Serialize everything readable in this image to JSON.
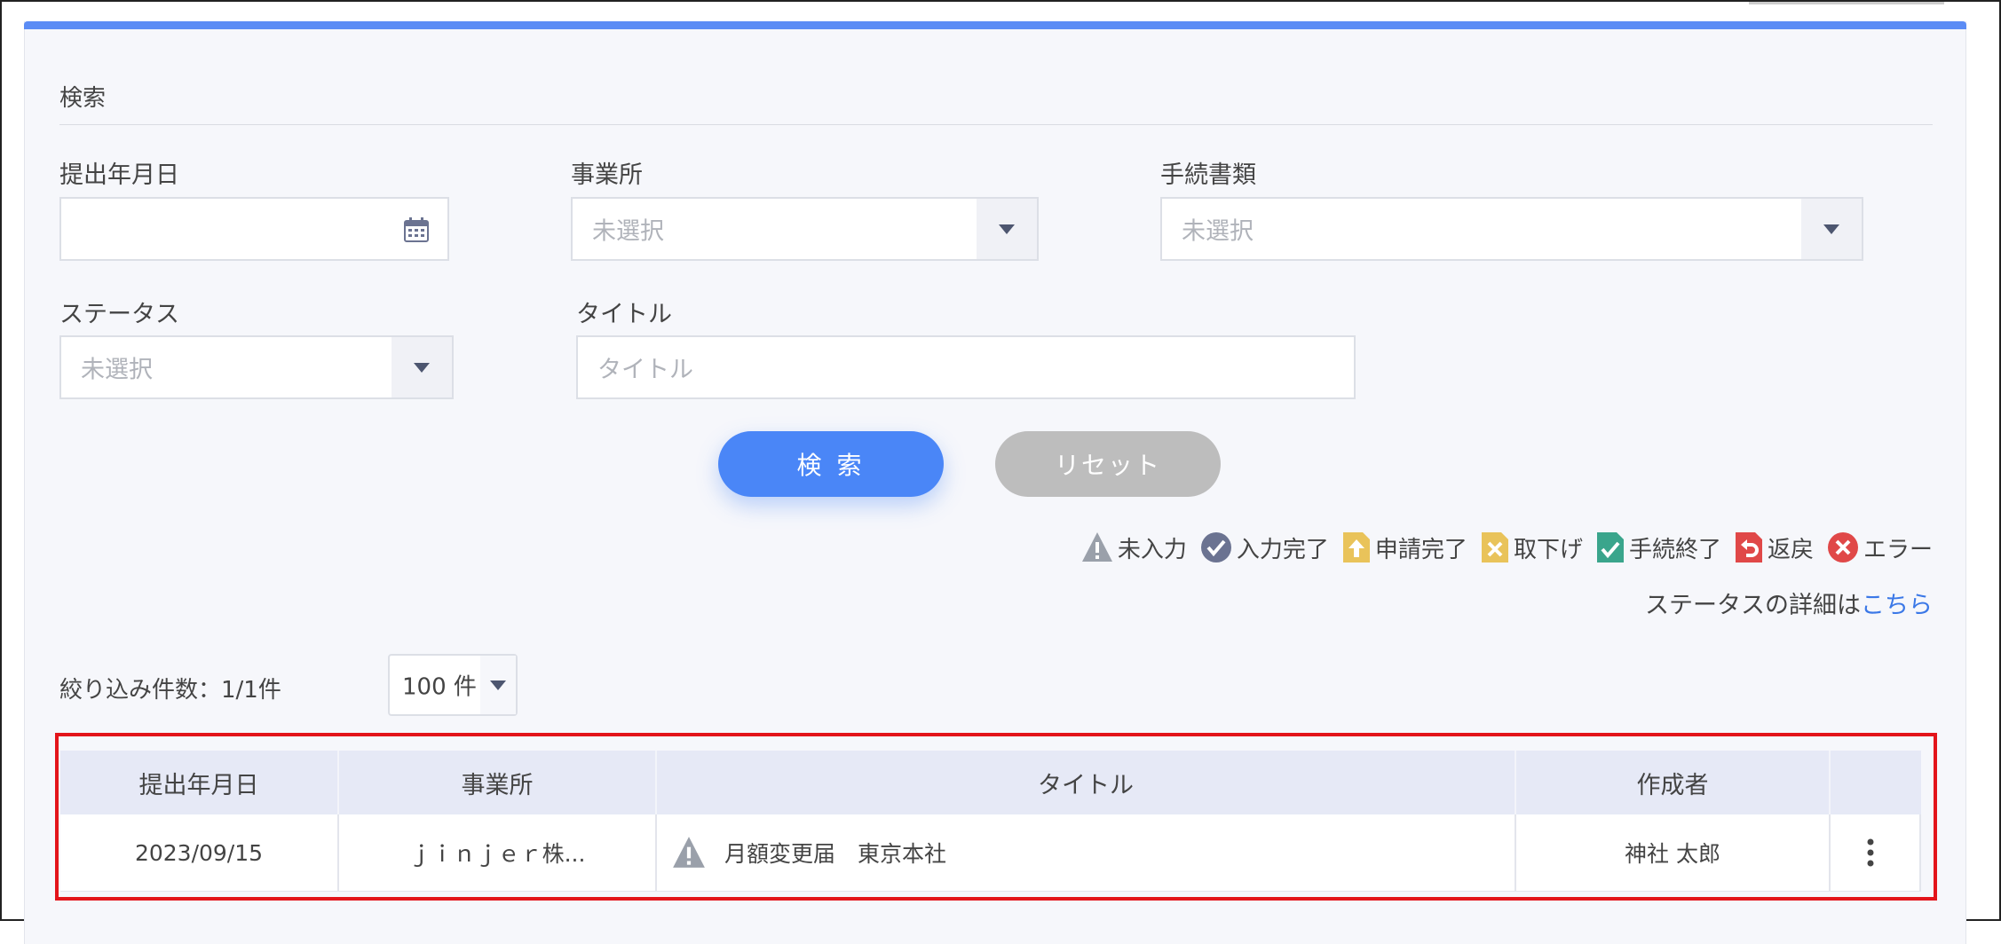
{
  "search": {
    "section_title": "検索",
    "date_label": "提出年月日",
    "office_label": "事業所",
    "office_placeholder": "未選択",
    "doc_label": "手続書類",
    "doc_placeholder": "未選択",
    "status_label": "ステータス",
    "status_placeholder": "未選択",
    "title_label": "タイトル",
    "title_placeholder": "タイトル",
    "search_button": "検 索",
    "reset_button": "リセット"
  },
  "legend": {
    "items": [
      {
        "label": "未入力",
        "icon": "warning-icon",
        "color": "#9aa0aa"
      },
      {
        "label": "入力完了",
        "icon": "check-circle-icon",
        "color": "#6b7391"
      },
      {
        "label": "申請完了",
        "icon": "upload-doc-icon",
        "color": "#e9c35a"
      },
      {
        "label": "取下げ",
        "icon": "withdraw-doc-icon",
        "color": "#e9c35a"
      },
      {
        "label": "手続終了",
        "icon": "complete-doc-icon",
        "color": "#3aa58c"
      },
      {
        "label": "返戻",
        "icon": "return-doc-icon",
        "color": "#e04848"
      },
      {
        "label": "エラー",
        "icon": "error-icon",
        "color": "#e04848"
      }
    ],
    "detail_text": "ステータスの詳細は",
    "detail_link": "こちら"
  },
  "results": {
    "count_text": "絞り込み件数：1/1件",
    "per_page": "100 件"
  },
  "table": {
    "headers": [
      "提出年月日",
      "事業所",
      "タイトル",
      "作成者"
    ],
    "rows": [
      {
        "date": "2023/09/15",
        "office": "ｊｉｎｊｅｒ株...",
        "status_icon": "warning-icon",
        "title": "月額変更届　東京本社",
        "author": "神社 太郎",
        "menu_icon": "more-vertical-icon"
      }
    ]
  },
  "colors": {
    "accent": "#4a86f7",
    "topbar": "#5b8cf5",
    "highlight_border": "#e3141a",
    "header_bg": "#e6e9f6"
  }
}
